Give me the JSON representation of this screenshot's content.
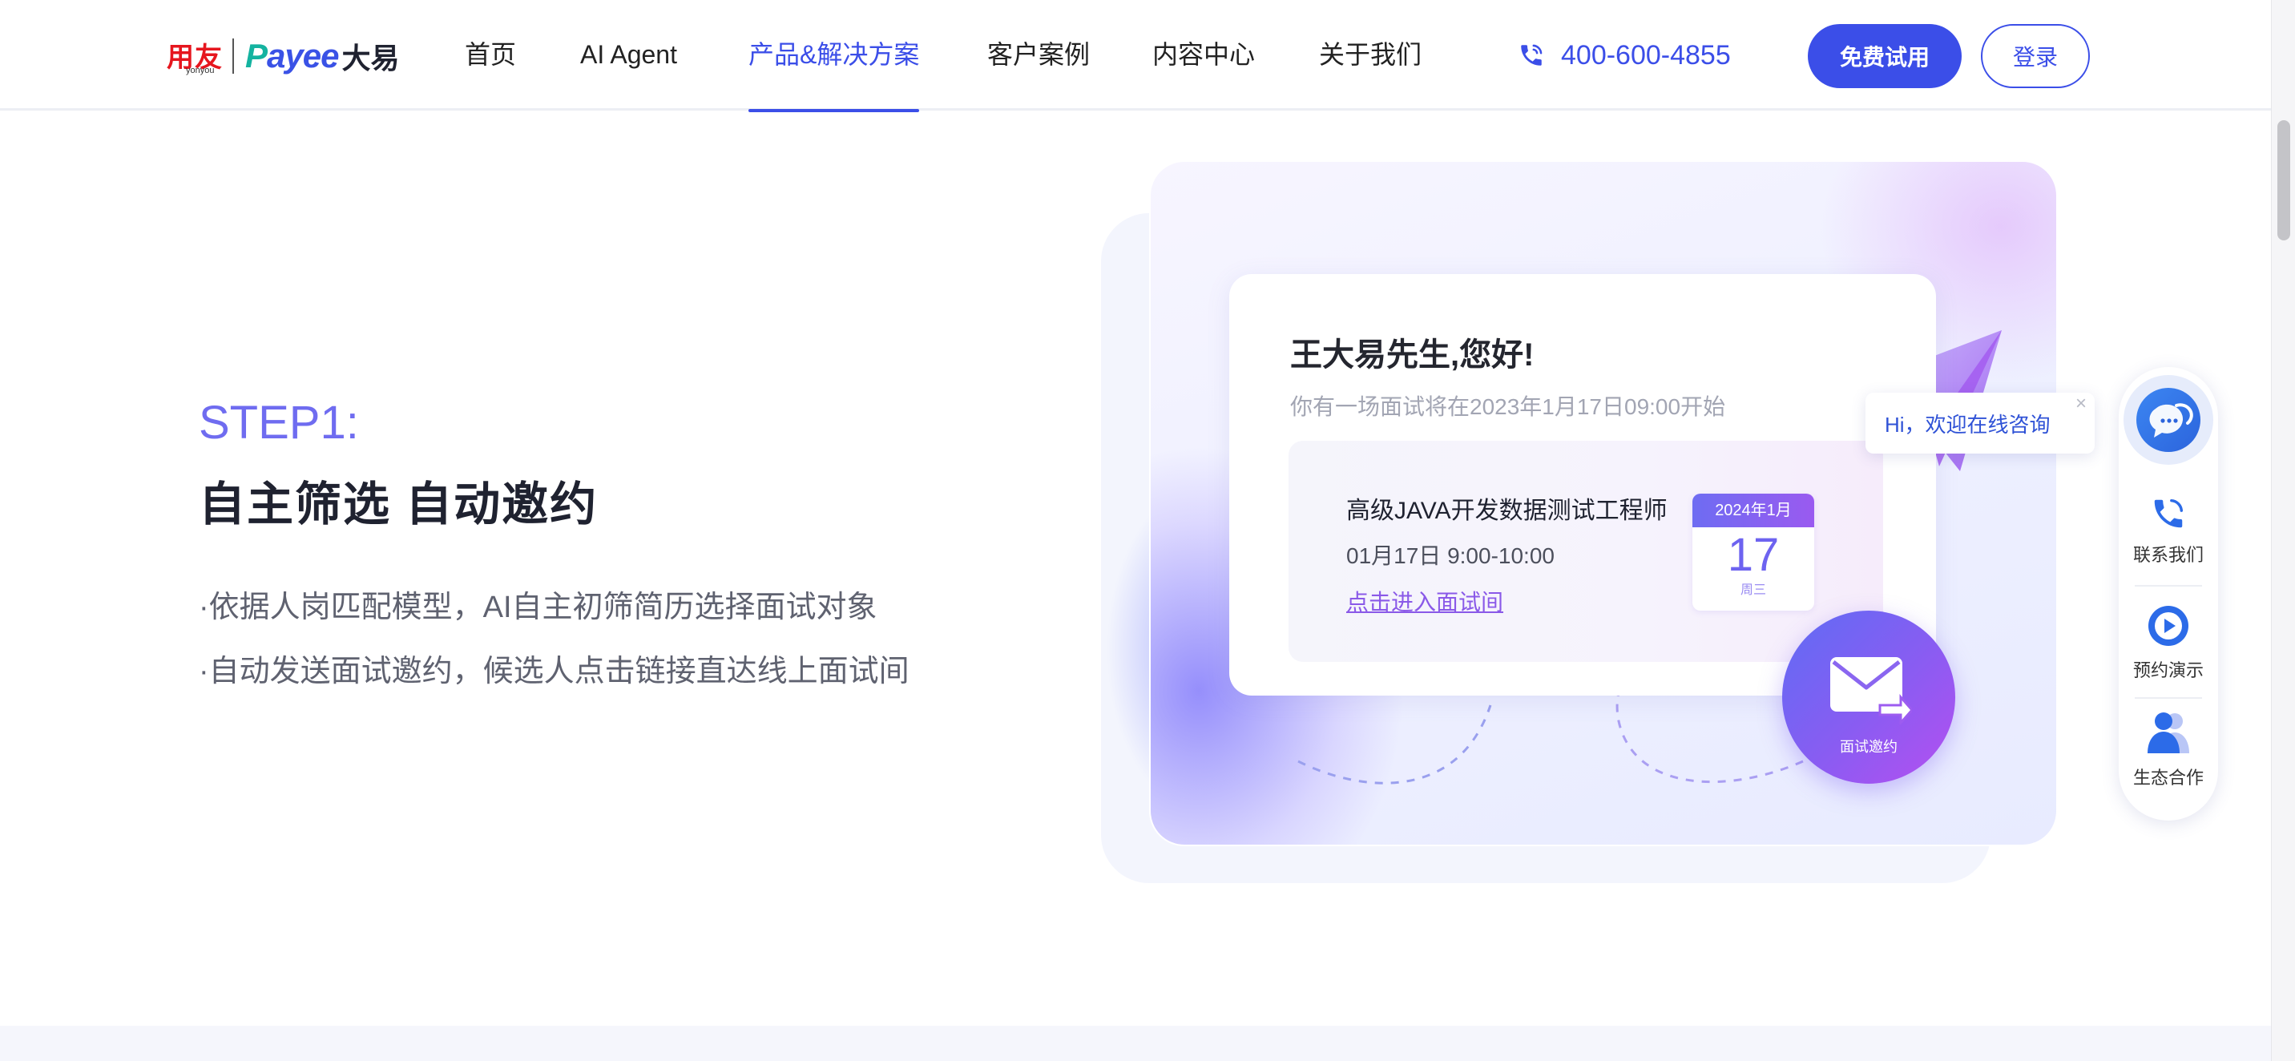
{
  "brand": {
    "logo_cn": "用友",
    "logo_en": "yonyou",
    "payee_p": "P",
    "payee_rest": "ayee",
    "dayi": "大易"
  },
  "nav": {
    "items": [
      {
        "label": "首页",
        "active": false
      },
      {
        "label": "AI Agent",
        "active": false
      },
      {
        "label": "产品&解决方案",
        "active": true
      },
      {
        "label": "客户案例",
        "active": false
      },
      {
        "label": "内容中心",
        "active": false
      },
      {
        "label": "关于我们",
        "active": false
      }
    ],
    "phone": "400-600-4855",
    "trial_button": "免费试用",
    "login_button": "登录"
  },
  "hero": {
    "step": "STEP1:",
    "title": "自主筛选 自动邀约",
    "bullets": [
      "·依据人岗匹配模型，AI自主初筛简历选择面试对象",
      "·自动发送面试邀约，候选人点击链接直达线上面试间"
    ]
  },
  "invite": {
    "greeting": "王大易先生,您好!",
    "subtitle": "你有一场面试将在2023年1月17日09:00开始",
    "job_title": "高级JAVA开发数据测试工程师",
    "time": "01月17日  9:00-10:00",
    "link": "点击进入面试间",
    "calendar": {
      "month": "2024年1月",
      "day": "17",
      "weekday": "周三"
    },
    "mail_label": "面试邀约"
  },
  "chat_bubble": {
    "text": "Hi，欢迎在线咨询",
    "close": "×"
  },
  "side_widget": {
    "items": [
      {
        "label": "联系我们",
        "icon": "phone-icon"
      },
      {
        "label": "预约演示",
        "icon": "play-icon"
      },
      {
        "label": "生态合作",
        "icon": "partner-icon"
      }
    ]
  },
  "colors": {
    "accent": "#3b4ee8",
    "step_purple": "#6f6cf0",
    "logo_red": "#e6161e",
    "logo_teal": "#14b3a0"
  }
}
